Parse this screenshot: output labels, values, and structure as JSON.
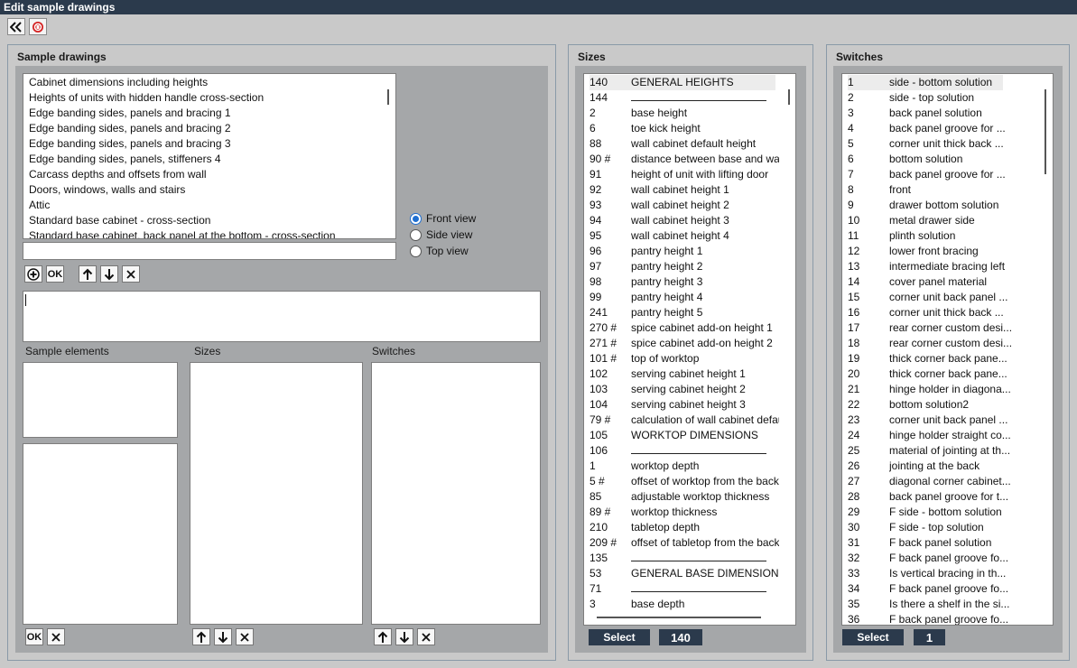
{
  "window": {
    "title": "Edit sample drawings"
  },
  "toolbar": {
    "back_icon": "double-chevron-left-icon",
    "stop_icon": "stop-icon"
  },
  "sample_drawings": {
    "title": "Sample drawings",
    "items": [
      "Cabinet dimensions including heights",
      "Heights of units with hidden handle cross-section",
      "Edge banding sides, panels and bracing 1",
      "Edge banding sides, panels and bracing 2",
      "Edge banding sides, panels and bracing 3",
      "Edge banding sides, panels, stiffeners 4",
      "Carcass depths and offsets from wall",
      "Doors, windows, walls and stairs",
      "Attic",
      "Standard base cabinet - cross-section",
      "Standard base cabinet, back panel at the bottom - cross-section"
    ],
    "name_input_value": "",
    "views": [
      {
        "label": "Front view",
        "checked": true
      },
      {
        "label": "Side view",
        "checked": false
      },
      {
        "label": "Top view",
        "checked": false
      }
    ],
    "ok_label": "OK",
    "description_value": "",
    "sample_elements_label": "Sample elements",
    "sizes_label": "Sizes",
    "switches_label": "Switches"
  },
  "sizes": {
    "title": "Sizes",
    "rows": [
      {
        "num": "140",
        "name": "GENERAL HEIGHTS",
        "selected": true
      },
      {
        "num": "144",
        "name": "",
        "separator": true
      },
      {
        "num": "2",
        "name": "base height"
      },
      {
        "num": "6",
        "name": "toe kick height"
      },
      {
        "num": "88",
        "name": "wall cabinet default height"
      },
      {
        "num": "90 #",
        "name": "distance between base and wall..."
      },
      {
        "num": "91",
        "name": "height of unit with lifting door"
      },
      {
        "num": "92",
        "name": "wall cabinet height 1"
      },
      {
        "num": "93",
        "name": "wall cabinet height 2"
      },
      {
        "num": "94",
        "name": "wall cabinet height 3"
      },
      {
        "num": "95",
        "name": "wall cabinet height 4"
      },
      {
        "num": "96",
        "name": "pantry height 1"
      },
      {
        "num": "97",
        "name": "pantry height 2"
      },
      {
        "num": "98",
        "name": "pantry height 3"
      },
      {
        "num": "99",
        "name": "pantry height 4"
      },
      {
        "num": "241",
        "name": "pantry height 5"
      },
      {
        "num": "270 #",
        "name": "spice cabinet add-on height 1"
      },
      {
        "num": "271 #",
        "name": "spice cabinet add-on height 2"
      },
      {
        "num": "101 #",
        "name": "top of worktop"
      },
      {
        "num": "102",
        "name": "serving cabinet height 1"
      },
      {
        "num": "103",
        "name": "serving cabinet height 2"
      },
      {
        "num": "104",
        "name": "serving cabinet height 3"
      },
      {
        "num": "79 #",
        "name": "calculation of wall cabinet defaul..."
      },
      {
        "num": "105",
        "name": "WORKTOP DIMENSIONS"
      },
      {
        "num": "106",
        "name": "",
        "separator": true
      },
      {
        "num": "1",
        "name": "worktop depth"
      },
      {
        "num": "5 #",
        "name": "offset of worktop from the back"
      },
      {
        "num": "85",
        "name": "adjustable worktop thickness"
      },
      {
        "num": "89 #",
        "name": "worktop thickness"
      },
      {
        "num": "210",
        "name": "tabletop depth"
      },
      {
        "num": "209 #",
        "name": "offset of tabletop from the back"
      },
      {
        "num": "135",
        "name": "",
        "separator": true
      },
      {
        "num": "53",
        "name": "GENERAL BASE DIMENSIONS"
      },
      {
        "num": "71",
        "name": "",
        "separator": true
      },
      {
        "num": "3",
        "name": "base depth"
      }
    ],
    "select_label": "Select",
    "selected_value": "140"
  },
  "switches": {
    "title": "Switches",
    "rows": [
      {
        "num": "1",
        "name": "side - bottom solution",
        "selected": true
      },
      {
        "num": "2",
        "name": "side - top solution"
      },
      {
        "num": "3",
        "name": "back panel solution"
      },
      {
        "num": "4",
        "name": "back panel groove for ..."
      },
      {
        "num": "5",
        "name": "corner unit thick back ..."
      },
      {
        "num": "6",
        "name": "bottom solution"
      },
      {
        "num": "7",
        "name": "back panel groove for ..."
      },
      {
        "num": "8",
        "name": "front"
      },
      {
        "num": "9",
        "name": "drawer bottom solution"
      },
      {
        "num": "10",
        "name": "metal drawer side"
      },
      {
        "num": "11",
        "name": "plinth solution"
      },
      {
        "num": "12",
        "name": "lower front bracing"
      },
      {
        "num": "13",
        "name": "intermediate bracing left"
      },
      {
        "num": "14",
        "name": "cover panel material"
      },
      {
        "num": "15",
        "name": "corner unit back panel ..."
      },
      {
        "num": "16",
        "name": "corner unit thick back ..."
      },
      {
        "num": "17",
        "name": "rear corner custom desi..."
      },
      {
        "num": "18",
        "name": "rear corner custom desi..."
      },
      {
        "num": "19",
        "name": "thick corner back pane..."
      },
      {
        "num": "20",
        "name": "thick corner back pane..."
      },
      {
        "num": "21",
        "name": "hinge holder in diagona..."
      },
      {
        "num": "22",
        "name": "bottom solution2"
      },
      {
        "num": "23",
        "name": "corner unit back panel ..."
      },
      {
        "num": "24",
        "name": "hinge holder straight co..."
      },
      {
        "num": "25",
        "name": "material of jointing at th..."
      },
      {
        "num": "26",
        "name": "jointing at the back"
      },
      {
        "num": "27",
        "name": "diagonal corner cabinet..."
      },
      {
        "num": "28",
        "name": "back panel groove for t..."
      },
      {
        "num": "29",
        "name": "F side - bottom solution"
      },
      {
        "num": "30",
        "name": "F side - top solution"
      },
      {
        "num": "31",
        "name": "F back panel solution"
      },
      {
        "num": "32",
        "name": "F back panel groove fo..."
      },
      {
        "num": "33",
        "name": "Is vertical bracing in th..."
      },
      {
        "num": "34",
        "name": "F back panel groove fo..."
      },
      {
        "num": "35",
        "name": "Is there a shelf in the si..."
      },
      {
        "num": "36",
        "name": "F back panel groove fo..."
      }
    ],
    "select_label": "Select",
    "selected_value": "1"
  }
}
